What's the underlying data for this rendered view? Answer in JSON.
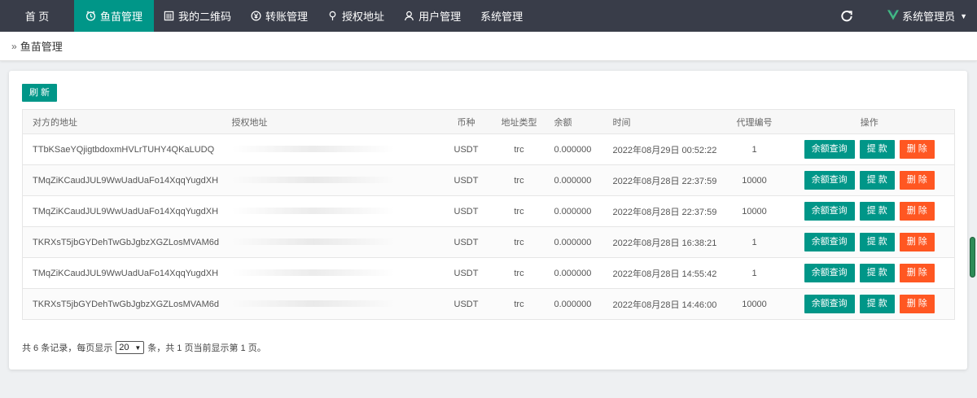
{
  "nav": {
    "home": "首 页",
    "items": [
      {
        "label": "鱼苗管理",
        "icon": "clock-icon",
        "active": true
      },
      {
        "label": "我的二维码",
        "icon": "qrcode-icon",
        "active": false
      },
      {
        "label": "转账管理",
        "icon": "yen-icon",
        "active": false
      },
      {
        "label": "授权地址",
        "icon": "location-pin-icon",
        "active": false
      },
      {
        "label": "用户管理",
        "icon": "user-icon",
        "active": false
      },
      {
        "label": "系统管理",
        "icon": "",
        "active": false
      }
    ],
    "admin": "系统管理员",
    "accent": "#009688"
  },
  "breadcrumb": {
    "current": "鱼苗管理"
  },
  "toolbar": {
    "refresh_label": "刷 新"
  },
  "table": {
    "headers": {
      "peer_address": "对方的地址",
      "auth_address": "授权地址",
      "currency": "币种",
      "addr_type": "地址类型",
      "balance": "余额",
      "time": "时间",
      "agent_id": "代理编号",
      "ops": "操作"
    },
    "rows": [
      {
        "peer_address": "TTbKSaeYQjigtbdoxmHVLrTUHY4QKaLUDQ",
        "currency": "USDT",
        "addr_type": "trc",
        "balance": "0.000000",
        "time": "2022年08月29日 00:52:22",
        "agent_id": "1"
      },
      {
        "peer_address": "TMqZiKCaudJUL9WwUadUaFo14XqqYugdXH",
        "currency": "USDT",
        "addr_type": "trc",
        "balance": "0.000000",
        "time": "2022年08月28日 22:37:59",
        "agent_id": "10000"
      },
      {
        "peer_address": "TMqZiKCaudJUL9WwUadUaFo14XqqYugdXH",
        "currency": "USDT",
        "addr_type": "trc",
        "balance": "0.000000",
        "time": "2022年08月28日 22:37:59",
        "agent_id": "10000"
      },
      {
        "peer_address": "TKRXsT5jbGYDehTwGbJgbzXGZLosMVAM6d",
        "currency": "USDT",
        "addr_type": "trc",
        "balance": "0.000000",
        "time": "2022年08月28日 16:38:21",
        "agent_id": "1"
      },
      {
        "peer_address": "TMqZiKCaudJUL9WwUadUaFo14XqqYugdXH",
        "currency": "USDT",
        "addr_type": "trc",
        "balance": "0.000000",
        "time": "2022年08月28日 14:55:42",
        "agent_id": "1"
      },
      {
        "peer_address": "TKRXsT5jbGYDehTwGbJgbzXGZLosMVAM6d",
        "currency": "USDT",
        "addr_type": "trc",
        "balance": "0.000000",
        "time": "2022年08月28日 14:46:00",
        "agent_id": "10000"
      }
    ],
    "op_labels": {
      "query": "余额查询",
      "withdraw": "提 款",
      "delete": "删 除"
    }
  },
  "pager": {
    "prefix": "共 6 条记录，每页显示",
    "page_size": "20",
    "suffix": "条，共 1 页当前显示第 1 页。"
  }
}
